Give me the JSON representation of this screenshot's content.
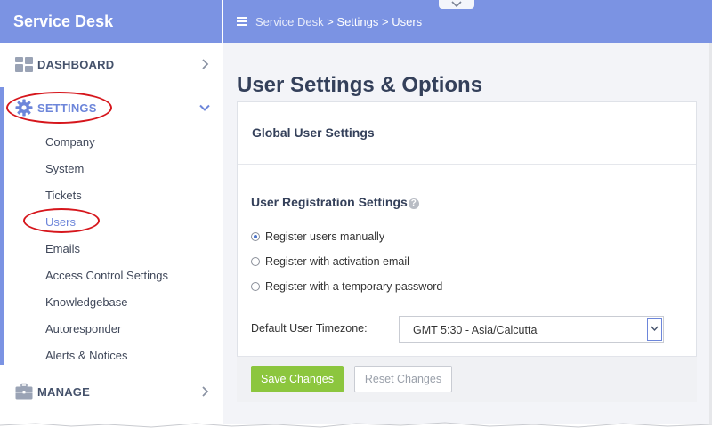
{
  "brand": "Service Desk",
  "breadcrumb": {
    "root": "Service Desk",
    "sep1": " > ",
    "section": "Settings",
    "sep2": " > ",
    "page": "Users"
  },
  "sidebar": {
    "dashboard": "DASHBOARD",
    "settings": "SETTINGS",
    "manage": "MANAGE",
    "sub_items": [
      "Company",
      "System",
      "Tickets",
      "Users",
      "Emails",
      "Access Control Settings",
      "Knowledgebase",
      "Autoresponder",
      "Alerts & Notices"
    ]
  },
  "page_title": "User Settings & Options",
  "panel": {
    "title": "Global User Settings",
    "section_title": "User Registration Settings",
    "help_glyph": "?",
    "radios": [
      {
        "label": "Register users manually",
        "checked": true
      },
      {
        "label": "Register with activation email",
        "checked": false
      },
      {
        "label": "Register with a temporary password",
        "checked": false
      }
    ],
    "timezone_label": "Default User Timezone:",
    "timezone_value": "GMT 5:30 - Asia/Calcutta"
  },
  "buttons": {
    "save": "Save Changes",
    "reset": "Reset Changes"
  },
  "colors": {
    "header": "#7b93e3",
    "accent": "#6d86da",
    "save": "#8cc63e",
    "annotation": "#d6161c"
  }
}
